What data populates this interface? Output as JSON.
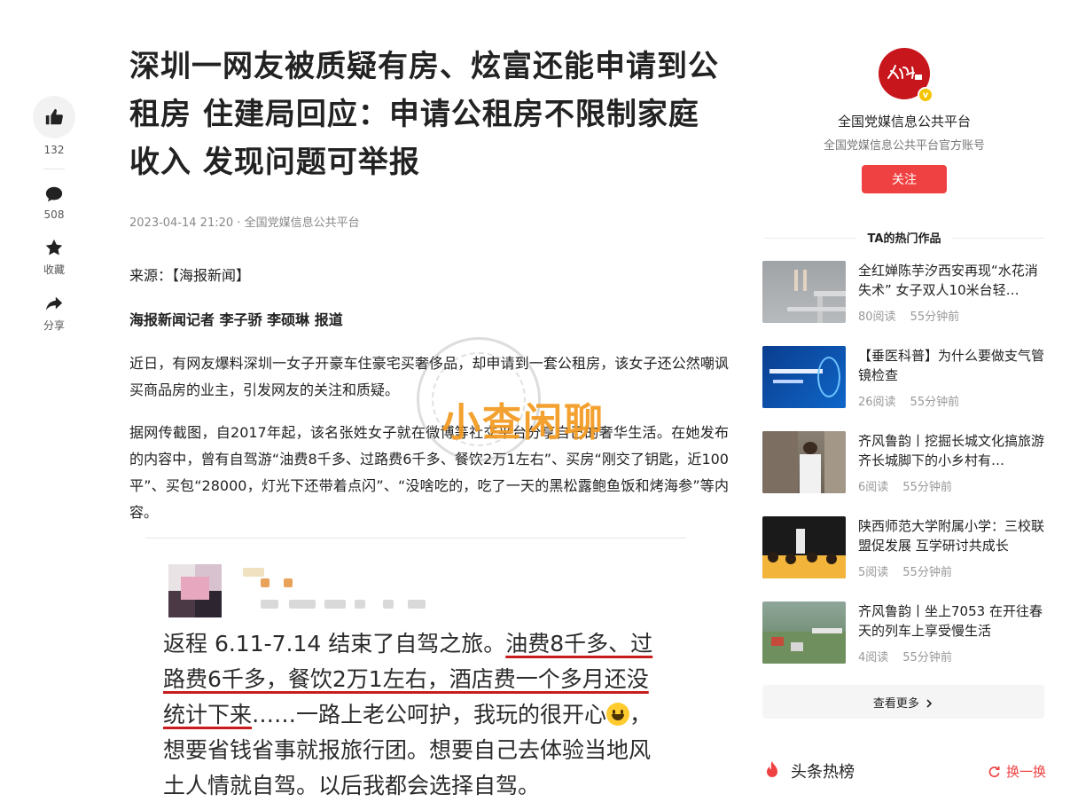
{
  "article": {
    "title": "深圳一网友被质疑有房、炫富还能申请到公租房 住建局回应：申请公租房不限制家庭收入 发现问题可举报",
    "date": "2023-04-14 21:20",
    "publisher": "全国党媒信息公共平台",
    "source": "来源：【海报新闻】",
    "reporter": "海报新闻记者 李子骄 李硕琳 报道",
    "paragraphs": [
      "近日，有网友爆料深圳一女子开豪车住豪宅买奢侈品，却申请到一套公租房，该女子还公然嘲讽买商品房的业主，引发网友的关注和质疑。",
      "据网传截图，自2017年起，该名张姓女子就在微博等社交平台分享自己的奢华生活。在她发布的内容中，曾有自驾游“油费8千多、过路费6千多、餐饮2万1左右”、买房“刚交了钥匙，近100平”、买包“28000，灯光下还带着点闪”、“没啥吃的，吃了一天的黑松露鲍鱼饭和烤海参”等内容。"
    ],
    "screenshot_post": {
      "p1": "返程 6.11-7.14 结束了自驾之旅。",
      "u1": "油费8千多、过",
      "u2": "路费6千多，餐饮2万1左右，酒店费一个多月还没",
      "u3": "统计下来",
      "p2": "……一路上老公呵护，我玩的很开心",
      "p3": "，",
      "p4": "想要省钱省事就报旅行团。想要自己去体验当地风",
      "p5": "土人情就自驾。以后我都会选择自驾。"
    },
    "watermark": "小查闲聊"
  },
  "rail": {
    "likes": "132",
    "comments": "508",
    "collect_label": "收藏",
    "share_label": "分享",
    "icons": [
      "thumbs-up-icon",
      "comment-icon",
      "star-icon",
      "share-icon"
    ]
  },
  "sidebar": {
    "author_name": "全国党媒信息公共平台",
    "author_desc": "全国党媒信息公共平台官方账号",
    "follow_label": "关注",
    "hot_works_title": "TA的热门作品",
    "works": [
      {
        "title": "全红婵陈芋汐西安再现“水花消失术” 女子双人10米台轻…",
        "reads": "80阅读",
        "time": "55分钟前"
      },
      {
        "title": "【垂医科普】为什么要做支气管镜检查",
        "reads": "26阅读",
        "time": "55分钟前"
      },
      {
        "title": "齐风鲁韵丨挖掘长城文化搞旅游 齐长城脚下的小乡村有…",
        "reads": "6阅读",
        "time": "55分钟前"
      },
      {
        "title": "陕西师范大学附属小学：三校联盟促发展 互学研讨共成长",
        "reads": "5阅读",
        "time": "55分钟前"
      },
      {
        "title": "齐风鲁韵丨坐上7053 在开往春天的列车上享受慢生活",
        "reads": "4阅读",
        "time": "55分钟前"
      }
    ],
    "more_label": "查看更多",
    "hotlist_title": "头条热榜",
    "swap_label": "换一换"
  },
  "colors": {
    "accent": "#f04142",
    "underline": "#c81d1d",
    "watermark": "#f39a1f"
  }
}
